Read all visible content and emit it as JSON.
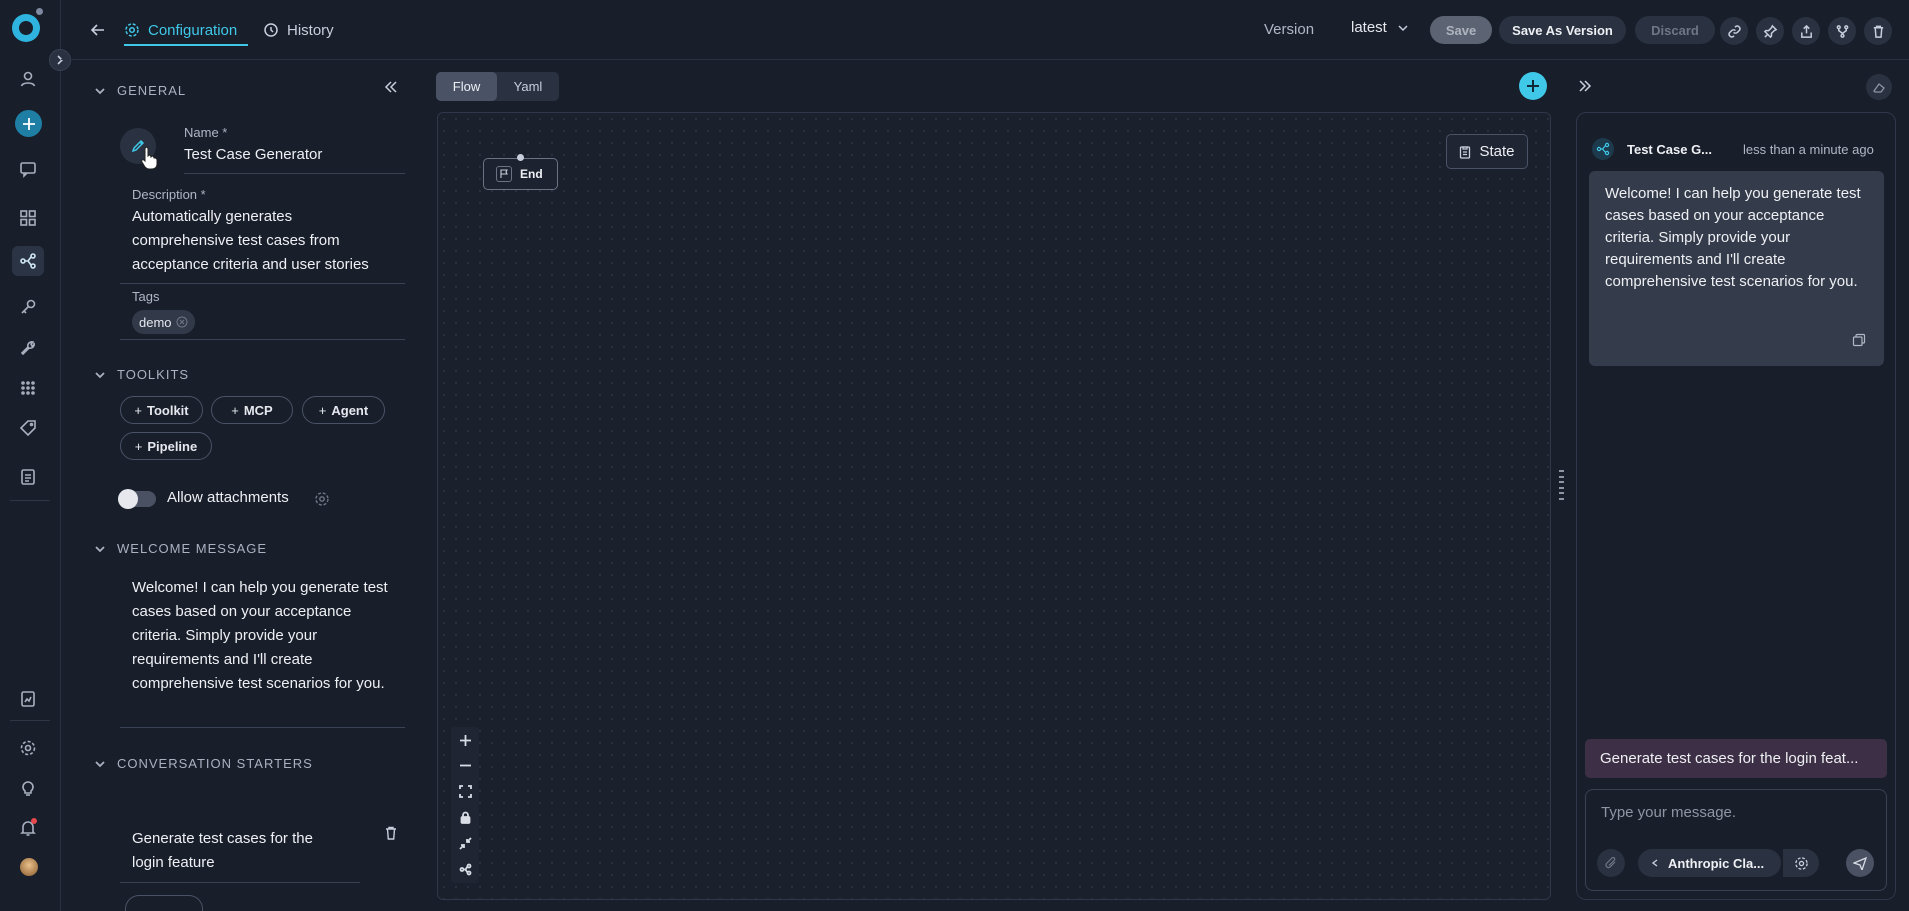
{
  "topbar": {
    "tabs": [
      {
        "label": "Configuration",
        "active": true
      },
      {
        "label": "History",
        "active": false
      }
    ],
    "version_label": "Version",
    "version_value": "latest",
    "save_label": "Save",
    "save_as_version_label": "Save As Version",
    "discard_label": "Discard",
    "icons": [
      "link-icon",
      "pin-icon",
      "share-icon",
      "fork-icon",
      "trash-icon"
    ]
  },
  "sidebar": {
    "icons": [
      "user-icon",
      "plus-icon",
      "chat-icon",
      "grid-icon",
      "pipeline-icon",
      "key-icon",
      "wrench-icon",
      "apps-icon",
      "tag-icon",
      "document-icon",
      "report-icon",
      "settings-icon",
      "bulb-icon",
      "bell-icon",
      "avatar"
    ]
  },
  "general": {
    "title": "GENERAL",
    "name_label": "Name",
    "name_value": "Test Case Generator",
    "description_label": "Description",
    "description_value": "Automatically generates comprehensive test cases from acceptance criteria and user stories",
    "tags_label": "Tags",
    "tags": [
      "demo"
    ]
  },
  "toolkits": {
    "title": "TOOLKITS",
    "buttons": [
      "Toolkit",
      "MCP",
      "Agent",
      "Pipeline"
    ],
    "allow_attachments_label": "Allow attachments"
  },
  "welcome": {
    "title": "WELCOME MESSAGE",
    "text": "Welcome! I can help you generate test cases based on your acceptance criteria. Simply provide your requirements and I'll create comprehensive test scenarios for you."
  },
  "starters": {
    "title": "CONVERSATION STARTERS",
    "items": [
      "Generate test cases for the login feature"
    ]
  },
  "canvas": {
    "view_tabs": [
      "Flow",
      "Yaml"
    ],
    "active_view": "Flow",
    "state_label": "State",
    "end_node_label": "End"
  },
  "chat": {
    "title": "Test Case G...",
    "time": "less than a minute ago",
    "message": "Welcome! I can help you generate test cases based on your acceptance criteria. Simply provide your requirements and I'll create comprehensive test scenarios for you.",
    "starter_chip": "Generate test cases for the login feat...",
    "input_placeholder": "Type your message.",
    "model_label": "Anthropic Cla..."
  },
  "colors": {
    "accent": "#3fc8e8",
    "background": "#181e2a",
    "starter_chip_bg": "#3d2f45"
  }
}
